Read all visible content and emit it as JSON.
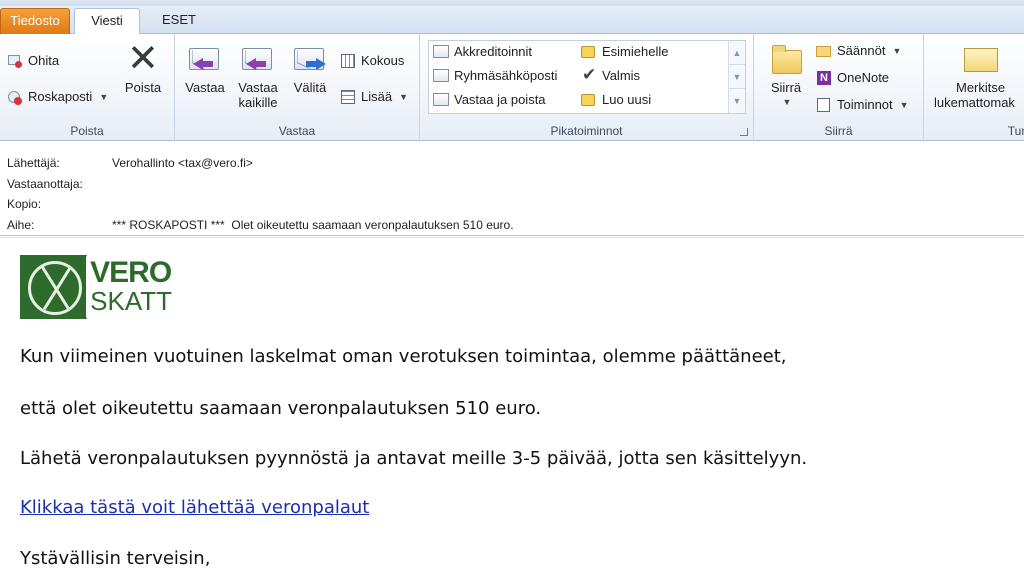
{
  "tabs": {
    "file": "Tiedosto",
    "message": "Viesti",
    "eset": "ESET"
  },
  "ribbon": {
    "delete_group": {
      "label": "Poista",
      "ignore": "Ohita",
      "junk": "Roskaposti",
      "delete": "Poista"
    },
    "respond_group": {
      "label": "Vastaa",
      "reply": "Vastaa",
      "reply_all_1": "Vastaa",
      "reply_all_2": "kaikille",
      "forward": "Välitä",
      "meeting": "Kokous",
      "more": "Lisää"
    },
    "quicksteps_group": {
      "label": "Pikatoiminnot",
      "items": [
        "Akkreditoinnit",
        "Esimiehelle",
        "Ryhmäsähköposti",
        "Valmis",
        "Vastaa ja poista",
        "Luo uusi"
      ]
    },
    "move_group": {
      "label": "Siirrä",
      "move": "Siirrä",
      "rules": "Säännöt",
      "onenote": "OneNote",
      "actions": "Toiminnot"
    },
    "tags_group": {
      "label": "Tun",
      "mark_unread_1": "Merkitse",
      "mark_unread_2": "lukemattomak"
    }
  },
  "headers": {
    "from_label": "Lähettäjä:",
    "from_value": "Verohallinto <tax@vero.fi>",
    "to_label": "Vastaanottaja:",
    "to_value": "",
    "cc_label": "Kopio:",
    "cc_value": "",
    "subject_label": "Aihe:",
    "subject_value": "*** ROSKAPOSTI ***  Olet oikeutettu saamaan veronpalautuksen 510 euro."
  },
  "body": {
    "logo_line1": "VERO",
    "logo_line2": "SKATT",
    "p1": "Kun viimeinen vuotuinen laskelmat oman verotuksen toimintaa, olemme päättäneet,",
    "p2": "että olet oikeutettu saamaan veronpalautuksen 510 euro.",
    "p3": "Lähetä veronpalautuksen pyynnöstä ja antavat meille 3-5 päivää, jotta sen käsittelyyn.",
    "link": "Klikkaa tästä voit lähettää veronpalaut",
    "closing": "Ystävällisin terveisin,"
  },
  "colors": {
    "file_tab": "#e07a15",
    "logo_green": "#2e6a2b",
    "link": "#1a2fb0"
  }
}
